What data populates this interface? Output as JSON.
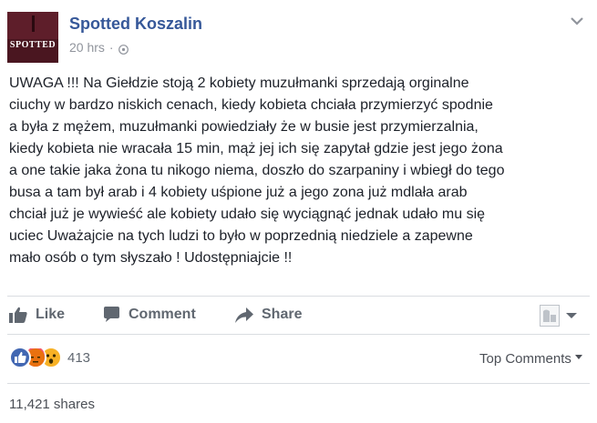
{
  "header": {
    "avatar_text": "SPOTTED",
    "page_name": "Spotted Koszalin",
    "timestamp": "20 hrs",
    "separator": "·",
    "privacy_icon": "globe-icon",
    "options_icon": "chevron-down-icon"
  },
  "post": {
    "text": "UWAGA !!! Na Giełdzie stoją 2 kobiety muzułmanki sprzedają orginalne\nciuchy w bardzo niskich cenach, kiedy kobieta chciała przymierzyć spodnie\na była z mężem, muzułmanki powiedziały że w busie jest przymierzalnia,\nkiedy kobieta nie wracała 15 min, mąż jej ich się zapytał gdzie jest jego żona\na one takie jaka żona tu nikogo niema, doszło do szarpaniny i wbiegł do tego\nbusa a tam był arab i 4 kobiety uśpione już a jego zona już mdlała arab\nchciał już je wywieść ale kobiety udało się wyciągnąć jednak udało mu się\nuciec Uważajcie na tych ludzi to było w poprzednią niedziele a zapewne\nmało osób o tym słyszało ! Udostępniajcie !!"
  },
  "actions": {
    "like_label": "Like",
    "comment_label": "Comment",
    "share_label": "Share"
  },
  "reactions": {
    "icons": [
      "like-reaction-icon",
      "angry-reaction-icon",
      "wow-reaction-icon"
    ],
    "count": "413",
    "top_comments_label": "Top Comments"
  },
  "shares": {
    "label": "11,421 shares"
  },
  "colors": {
    "link_blue": "#365899",
    "meta_gray": "#90949c",
    "action_gray": "#606770",
    "like_blue": "#4267b2",
    "angry_orange": "#f25268",
    "wow_yellow": "#f7b125"
  }
}
